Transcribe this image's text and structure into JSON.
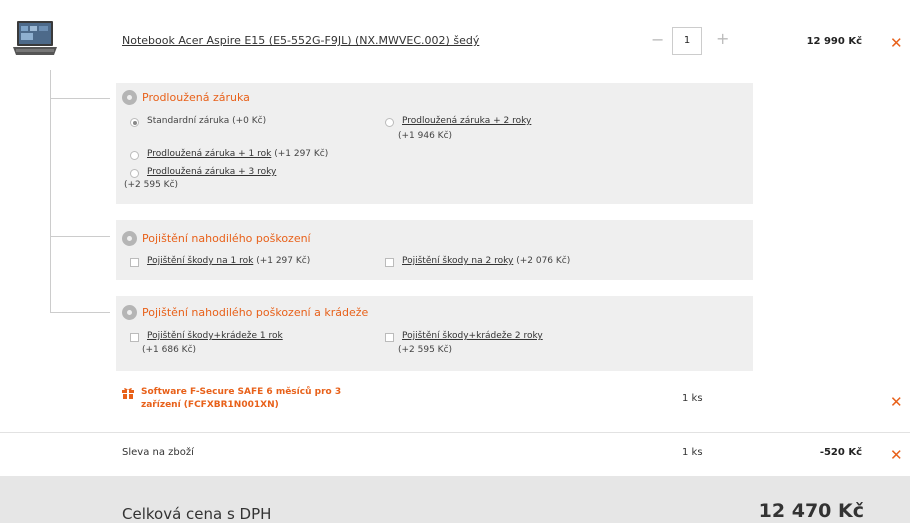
{
  "product": {
    "name": "Notebook Acer Aspire E15 (E5-552G-F9JL) (NX.MWVEC.002) šedý",
    "qty_minus": "−",
    "qty": "1",
    "qty_plus": "+",
    "price": "12 990 Kč",
    "remove": "✕"
  },
  "warranty": {
    "title": "Prodloužená záruka",
    "options": [
      {
        "label": "Standardní záruka (+0 Kč)",
        "selected": true
      },
      {
        "label": "Prodloužená záruka + 2 roky",
        "price": "(+1 946 Kč)"
      },
      {
        "label": "Prodloužená záruka + 1 rok",
        "price": "(+1 297 Kč)"
      },
      {
        "label": "Prodloužená záruka + 3 roky",
        "price": "(+2 595 Kč)"
      }
    ]
  },
  "damage": {
    "title": "Pojištění nahodilého poškození",
    "options": [
      {
        "label": "Pojištění škody na 1 rok",
        "price": "(+1 297 Kč)"
      },
      {
        "label": "Pojištění škody na 2 roky",
        "price": "(+2 076 Kč)"
      }
    ]
  },
  "theft": {
    "title": "Pojištění nahodilého poškození a krádeže",
    "options": [
      {
        "label": "Pojištění škody+krádeže 1 rok",
        "price": "(+1 686 Kč)"
      },
      {
        "label": "Pojištění škody+krádeže 2 roky",
        "price": "(+2 595 Kč)"
      }
    ]
  },
  "gift": {
    "name": "Software F-Secure SAFE 6 měsíců pro 3 zařízení (FCFXBR1N001XN)",
    "qty": "1 ks",
    "remove": "✕"
  },
  "discount": {
    "label": "Sleva na zboží",
    "qty": "1 ks",
    "value": "-520 Kč",
    "remove": "✕"
  },
  "total": {
    "label": "Celková cena s DPH",
    "value": "12 470 Kč"
  },
  "colors": {
    "accent": "#e8611a",
    "panel": "#efefef",
    "total_bar": "#e6e6e6"
  }
}
